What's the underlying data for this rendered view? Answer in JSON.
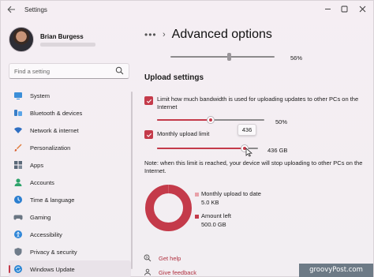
{
  "window": {
    "title": "Settings",
    "back_icon": "arrow-left-icon",
    "controls": [
      "minimize-icon",
      "maximize-icon",
      "close-icon"
    ]
  },
  "user": {
    "name": "Brian Burgess"
  },
  "search": {
    "placeholder": "Find a setting",
    "icon": "search-icon"
  },
  "sidebar": {
    "items": [
      {
        "label": "System",
        "icon": "monitor-icon",
        "active": false
      },
      {
        "label": "Bluetooth & devices",
        "icon": "bluetooth-icon",
        "active": false
      },
      {
        "label": "Network & internet",
        "icon": "wifi-icon",
        "active": false
      },
      {
        "label": "Personalization",
        "icon": "brush-icon",
        "active": false
      },
      {
        "label": "Apps",
        "icon": "apps-icon",
        "active": false
      },
      {
        "label": "Accounts",
        "icon": "person-icon",
        "active": false
      },
      {
        "label": "Time & language",
        "icon": "globe-clock-icon",
        "active": false
      },
      {
        "label": "Gaming",
        "icon": "gamepad-icon",
        "active": false
      },
      {
        "label": "Accessibility",
        "icon": "accessibility-icon",
        "active": false
      },
      {
        "label": "Privacy & security",
        "icon": "shield-icon",
        "active": false
      },
      {
        "label": "Windows Update",
        "icon": "windows-update-icon",
        "active": true
      }
    ]
  },
  "header": {
    "more": "•••",
    "chevron": "›",
    "title": "Advanced options"
  },
  "top_slider": {
    "value_label": "56%",
    "value": 56
  },
  "upload": {
    "section_title": "Upload settings",
    "bandwidth": {
      "checked": true,
      "label": "Limit how much bandwidth is used for uploading updates to other PCs on the Internet",
      "value_label": "50%",
      "value": 50
    },
    "monthly": {
      "checked": true,
      "label": "Monthly upload limit",
      "value_label": "436 GB",
      "tooltip": "436",
      "fraction": 0.87
    },
    "note": "Note: when this limit is reached, your device will stop uploading to other PCs on the Internet.",
    "usage": {
      "uploaded_label": "Monthly upload to date",
      "uploaded_value": "5.0 KB",
      "remaining_label": "Amount left",
      "remaining_value": "500.0 GB",
      "uploaded_color": "#e8a0a8",
      "remaining_color": "#c43a4a"
    }
  },
  "links": {
    "help": "Get help",
    "feedback": "Give feedback"
  },
  "watermark": "groovyPost.com",
  "colors": {
    "accent": "#c43a4a"
  }
}
